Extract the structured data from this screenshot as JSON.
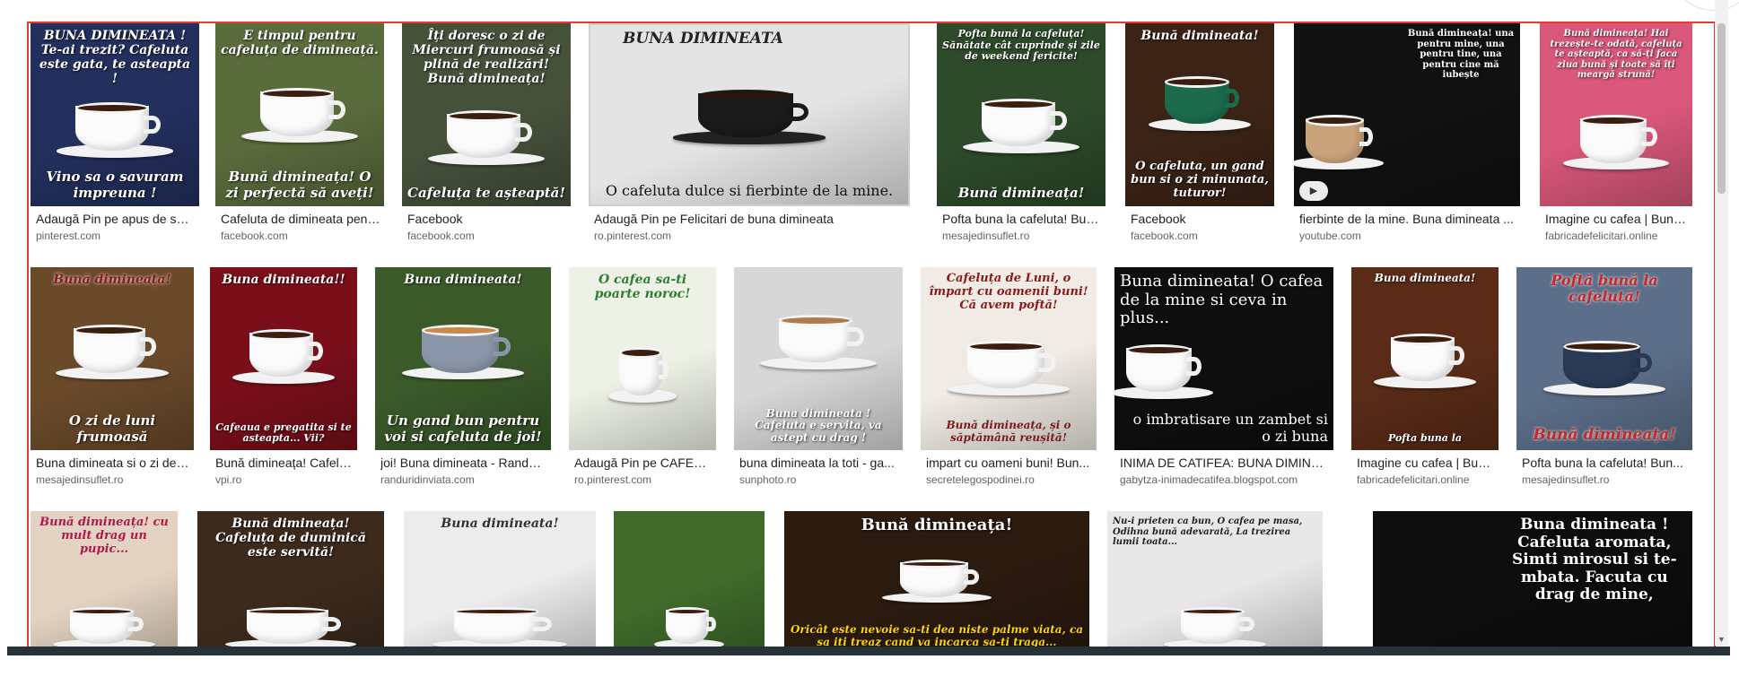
{
  "rows": [
    {
      "tiles": [
        {
          "title": "Adaugă Pin pe apus de soare",
          "source": "pinterest.com",
          "caption_top": "BUNA DIMINEATA ! Te-ai trezit? Cafeluta este gata, te asteapta !",
          "caption_bottom": "Vino sa o savuram impreuna !",
          "bg": "#23305e"
        },
        {
          "title": "Cafeluta de dimineata pentru ...",
          "source": "facebook.com",
          "caption_top": "E timpul pentru cafeluța de dimineață.",
          "caption_bottom": "Bună dimineața! O zi perfectă să aveți!",
          "bg": "#5a6b3c"
        },
        {
          "title": "Facebook",
          "source": "facebook.com",
          "caption_top": "Îți doresc o zi de Miercuri frumoasă și plină de realizări! Bună dimineața!",
          "caption_bottom": "Cafeluța te așteaptă!",
          "bg": "#46513a"
        },
        {
          "title": "Adaugă Pin pe Felicitari de buna dimineata",
          "source": "ro.pinterest.com",
          "caption_top": "BUNA DIMINEATA",
          "caption_bottom": "O cafeluta dulce si fierbinte de la mine.",
          "bg": "#e4e4e4"
        },
        {
          "title": "Pofta buna la cafeluta! Bună ...",
          "source": "mesajedinsuflet.ro",
          "caption_top": "Pofta bună la cafeluța! Sănătate cât cuprinde și zile de weekend fericite!",
          "caption_bottom": "Bună dimineața!",
          "bg": "#2d4a2a"
        },
        {
          "title": "Facebook",
          "source": "facebook.com",
          "caption_top": "Bună dimineata!",
          "caption_bottom": "O cafeluta, un gand bun si o zi minunata, tuturor!",
          "bg": "#3b2416"
        },
        {
          "title": "fierbinte de la mine. Buna dimineata ...",
          "source": "youtube.com",
          "caption_top": "Bună dimineața! una pentru mine, una pentru tine, una pentru cine mă iubește",
          "caption_bottom": "",
          "bg": "#111111",
          "video": true
        },
        {
          "title": "Imagine cu cafea | Buna ...",
          "source": "fabricadefelicitari.online",
          "caption_top": "Bună dimineața! Hai trezește-te odată, cafeluța te așteaptă, ca să-ți faca ziua bună și toate să îți meargă strună!",
          "caption_bottom": "",
          "bg": "#d9577a"
        }
      ]
    },
    {
      "tiles": [
        {
          "title": "Buna dimineata si o zi de l...",
          "source": "mesajedinsuflet.ro",
          "caption_top": "Bună dimineața!",
          "caption_bottom": "O zi de luni frumoasă",
          "bg": "#6b4a2a"
        },
        {
          "title": "Bună dimineața! Cafelu...",
          "source": "vpi.ro",
          "caption_top": "Buna dimineata!!",
          "caption_bottom": "Cafeaua e pregatita si te asteapta... Vii?",
          "bg": "#7a0f1a"
        },
        {
          "title": "joi! Buna dimineata - Randuri ...",
          "source": "randuridinviata.com",
          "caption_top": "Buna dimineata!",
          "caption_bottom": "Un gand bun pentru voi si cafeluta de joi!",
          "bg": "#3a5a2a"
        },
        {
          "title": "Adaugă Pin pe CAFELU...",
          "source": "ro.pinterest.com",
          "caption_top": "O cafea sa-ti poarte noroc!",
          "caption_bottom": "",
          "bg": "#eef2e6"
        },
        {
          "title": "buna dimineata la toti - ga...",
          "source": "sunphoto.ro",
          "caption_top": "",
          "caption_bottom": "Buna dimineata ! Cafeluta e servita, va astept cu drag !",
          "bg": "#d7d7d7"
        },
        {
          "title": "impart cu oameni buni! Bun...",
          "source": "secretelegospodinei.ro",
          "caption_top": "Cafeluța de Luni, o împart cu oamenii buni! Că avem poftă!",
          "caption_bottom": "Bună dimineața, și o săptămână reușită!",
          "bg": "#f0ebe4"
        },
        {
          "title": "INIMA DE CATIFEA: BUNA DIMINEA...",
          "source": "gabytza-inimadecatifea.blogspot.com",
          "caption_top": "Buna dimineata! O cafea de la mine si ceva in plus...",
          "caption_bottom": "o imbratisare un zambet si o zi buna",
          "bg": "#0e0e0e"
        },
        {
          "title": "Imagine cu cafea | Bun...",
          "source": "fabricadefelicitari.online",
          "caption_top": "Buna dimineata!",
          "caption_bottom": "Pofta buna la",
          "bg": "#5a2c18"
        },
        {
          "title": "Pofta buna la cafeluta! Bun...",
          "source": "mesajedinsuflet.ro",
          "caption_top": "Poftă bună la cafeluță!",
          "caption_bottom": "Bună dimineața!",
          "bg": "#5c6f8a"
        }
      ]
    },
    {
      "tiles": [
        {
          "caption_top": "Bună dimineața! cu mult drag un pupic...",
          "caption_bottom": "",
          "bg": "#e3d3c2"
        },
        {
          "caption_top": "Bună dimineața! Cafeluța de duminică este servită!",
          "caption_bottom": "",
          "bg": "#3c2a1c"
        },
        {
          "caption_top": "Buna dimineata!",
          "caption_bottom": "",
          "bg": "#ececec"
        },
        {
          "caption_top": "",
          "caption_bottom": "",
          "bg": "#3f6a2a"
        },
        {
          "caption_top": "Bună dimineața!",
          "caption_bottom": "Oricât este nevoie sa-ti dea niste palme viata, ca sa iti treaz cand va incarca sa-ti traga...",
          "bg": "#2b1a0e"
        },
        {
          "caption_top": "Nu-i prieten ca bun, O cafea pe masa, Odihna bună adevarată, La trezirea lumii toata...",
          "caption_bottom": "",
          "bg": "#e8e8e8"
        },
        {
          "caption_top": "Buna dimineata ! Cafeluta aromata, Simti mirosul si te-mbata. Facuta cu drag de mine,",
          "caption_bottom": "",
          "bg": "#0d0d0d"
        }
      ]
    }
  ],
  "colors": {
    "frame_border": "#e53935",
    "title_text": "#202124",
    "source_text": "#5f6368"
  },
  "icons": {
    "video_badge": "play-icon",
    "scroll_down": "chevron-down-icon"
  }
}
